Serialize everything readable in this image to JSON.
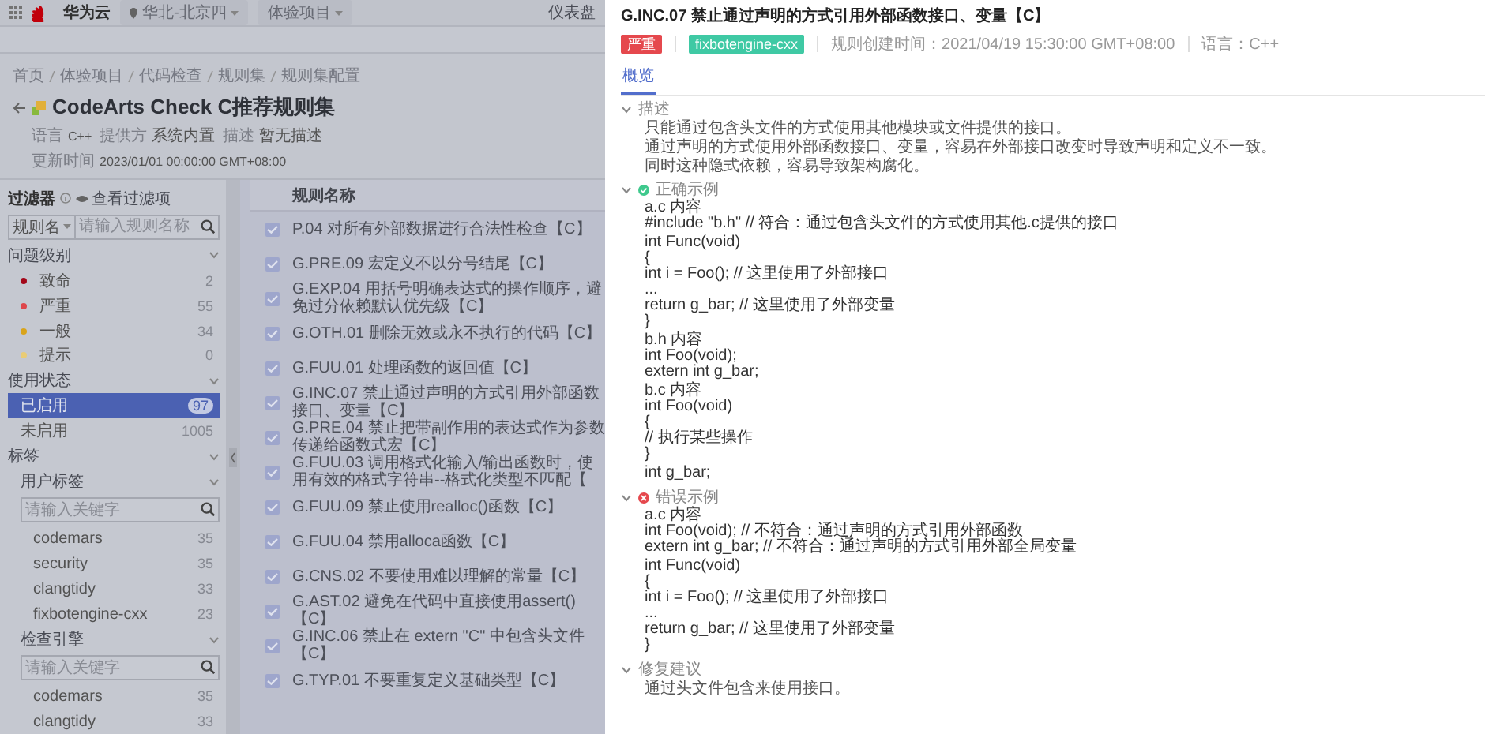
{
  "top_bar": {
    "brand": "华为云",
    "region": "华北-北京四",
    "project": "体验项目",
    "link": "仪表盘"
  },
  "breadcrumb": [
    "首页",
    "体验项目",
    "代码检查",
    "规则集",
    "规则集配置"
  ],
  "ruleset": {
    "title": "CodeArts Check C推荐规则集",
    "meta": [
      {
        "label": "语言",
        "value": "C++"
      },
      {
        "label": "提供方",
        "value": "系统内置"
      },
      {
        "label": "描述",
        "value": "暂无描述"
      },
      {
        "label": "更新时间",
        "value": "2023/01/01 00:00:00 GMT+08:00"
      }
    ]
  },
  "filter": {
    "title": "过滤器",
    "view_filters": "查看过滤项",
    "field_select": "规则名",
    "search_placeholder": "请输入规则名称",
    "groups": [
      {
        "title": "问题级别",
        "kind": "severity",
        "expanded": true,
        "items": [
          {
            "label": "致命",
            "count": "2",
            "color": "#a8071a"
          },
          {
            "label": "严重",
            "count": "55",
            "color": "#e5484d"
          },
          {
            "label": "一般",
            "count": "34",
            "color": "#e0a91c"
          },
          {
            "label": "提示",
            "count": "0",
            "color": "#f0d27a"
          }
        ]
      },
      {
        "title": "使用状态",
        "kind": "status",
        "expanded": true,
        "items": [
          {
            "label": "已启用",
            "count": "97",
            "selected": true
          },
          {
            "label": "未启用",
            "count": "1005",
            "selected": false
          }
        ]
      },
      {
        "title": "标签",
        "kind": "tags",
        "expanded": true,
        "subgroups": [
          {
            "title": "用户标签",
            "expanded": true,
            "placeholder": "请输入关键字",
            "items": [
              {
                "label": "codemars",
                "count": "35"
              },
              {
                "label": "security",
                "count": "35"
              },
              {
                "label": "clangtidy",
                "count": "33"
              },
              {
                "label": "fixbotengine-cxx",
                "count": "23"
              }
            ]
          },
          {
            "title": "检查引擎",
            "expanded": true,
            "placeholder": "请输入关键字",
            "items": [
              {
                "label": "codemars",
                "count": "35"
              },
              {
                "label": "clangtidy",
                "count": "33"
              }
            ]
          }
        ]
      }
    ]
  },
  "rules": {
    "column": "规则名称",
    "rows": [
      {
        "name": "P.04 对所有外部数据进行合法性检查【C】",
        "checked": true
      },
      {
        "name": "G.PRE.09 宏定义不以分号结尾【C】",
        "checked": true
      },
      {
        "name": "G.EXP.04 用括号明确表达式的操作顺序，避免过分依赖默认优先级【C】",
        "checked": true
      },
      {
        "name": "G.OTH.01 删除无效或永不执行的代码【C】",
        "checked": true
      },
      {
        "name": "G.FUU.01 处理函数的返回值【C】",
        "checked": true
      },
      {
        "name": "G.INC.07 禁止通过声明的方式引用外部函数接口、变量【C】",
        "checked": true
      },
      {
        "name": "G.PRE.04 禁止把带副作用的表达式作为参数传递给函数式宏【C】",
        "checked": true
      },
      {
        "name": "G.FUU.03 调用格式化输入/输出函数时，使用有效的格式字符串--格式化类型不匹配【",
        "checked": true
      },
      {
        "name": "G.FUU.09 禁止使用realloc()函数【C】",
        "checked": true
      },
      {
        "name": "G.FUU.04 禁用alloca函数【C】",
        "checked": true
      },
      {
        "name": "G.CNS.02 不要使用难以理解的常量【C】",
        "checked": true
      },
      {
        "name": "G.AST.02 避免在代码中直接使用assert()【C】",
        "checked": true
      },
      {
        "name": "G.INC.06 禁止在 extern \"C\" 中包含头文件【C】",
        "checked": true
      },
      {
        "name": "G.TYP.01 不要重复定义基础类型【C】",
        "checked": true
      }
    ]
  },
  "drawer": {
    "title": "G.INC.07 禁止通过声明的方式引用外部函数接口、变量【C】",
    "tags": [
      {
        "label": "严重",
        "color": "#e5484d"
      },
      {
        "label": "fixbotengine-cxx",
        "color": "#3fc9a4"
      }
    ],
    "info": [
      "规则创建时间：2021/04/19 15:30:00 GMT+08:00",
      "语言：C++"
    ],
    "tabs": [
      {
        "label": "概览",
        "selected": true
      }
    ],
    "sections": [
      {
        "title": "描述",
        "kind": "text",
        "expanded": true,
        "blocks": [
          [
            "只能通过包含头文件的方式使用其他模块或文件提供的接口。"
          ],
          [
            "通过声明的方式使用外部函数接口、变量，容易在外部接口改变时导致声明和定义不一致。"
          ],
          [
            "同时这种隐式依赖，容易导致架构腐化。"
          ]
        ]
      },
      {
        "title": "正确示例",
        "kind": "correct",
        "expanded": true,
        "blocks": [
          [
            "a.c 内容",
            "#include \"b.h\" // 符合：通过包含头文件的方式使用其他.c提供的接口"
          ],
          [
            "int Func(void)",
            "{",
            "int i = Foo(); // 这里使用了外部接口",
            "...",
            "return g_bar; // 这里使用了外部变量",
            "}"
          ],
          [
            "b.h 内容",
            "int Foo(void);",
            "extern int g_bar;"
          ],
          [
            "b.c 内容",
            "int Foo(void)",
            "{",
            "// 执行某些操作",
            "}"
          ],
          [
            "int g_bar;"
          ]
        ]
      },
      {
        "title": "错误示例",
        "kind": "wrong",
        "expanded": true,
        "blocks": [
          [
            "a.c 内容",
            "int Foo(void); // 不符合：通过声明的方式引用外部函数",
            "extern int g_bar; // 不符合：通过声明的方式引用外部全局变量"
          ],
          [
            "int Func(void)",
            "{",
            "int i = Foo(); // 这里使用了外部接口",
            "...",
            "return g_bar; // 这里使用了外部变量",
            "}"
          ]
        ]
      },
      {
        "title": "修复建议",
        "kind": "text",
        "expanded": true,
        "blocks": [
          [
            "通过头文件包含来使用接口。"
          ]
        ]
      }
    ]
  }
}
